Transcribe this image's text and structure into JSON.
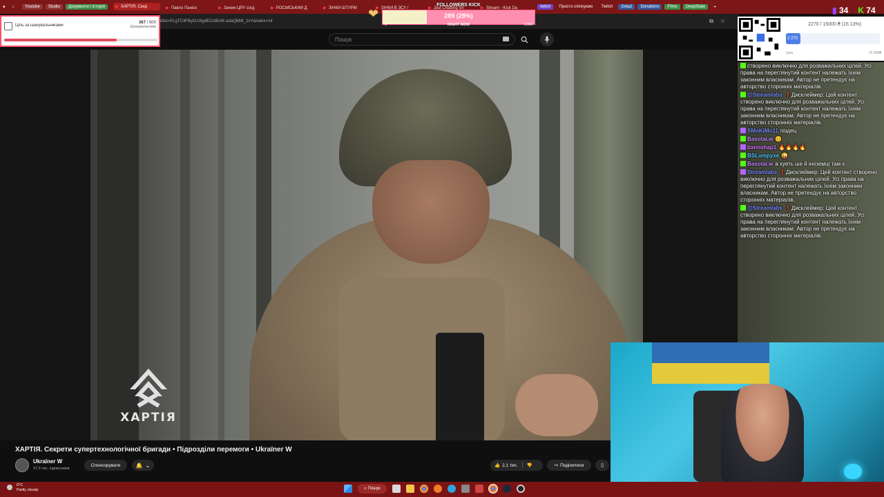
{
  "browser": {
    "bookmarks": [
      {
        "label": "Youtube",
        "color": "#8f3535"
      },
      {
        "label": "Studio",
        "color": "#8f3535"
      },
      {
        "label": "Документи і Історія",
        "color": "#3f8e4a"
      }
    ],
    "tabs": [
      {
        "label": "ХАРТІЯ. Секр",
        "active": true
      },
      {
        "label": "Павло Паніск"
      },
      {
        "label": "Зачем ЦРУ согд"
      },
      {
        "label": "РОСІЙСЬКИЙ Д"
      },
      {
        "label": "ЗІНКИ ШТУРМ"
      },
      {
        "label": "ЗІНКИ В ЗСУ /"
      },
      {
        "label": "Just Chatting Sh"
      },
      {
        "label": "Stream - Kick Da"
      }
    ],
    "bookmarks_right": [
      {
        "label": "twitch",
        "color": "#6b44c4"
      },
      {
        "label": "Просто спілкуємо",
        "color": "#7d1616"
      },
      {
        "label": "Twitch",
        "color": "#7d1616"
      },
      {
        "label": "Dota2",
        "color": "#365a9c"
      },
      {
        "label": "Donations",
        "color": "#365a9c"
      },
      {
        "label": "Films",
        "color": "#3f8e4a"
      },
      {
        "label": "DeepState",
        "color": "#3f8e4a"
      }
    ],
    "url": "dlist=PLgTC4FByDU3Ig4ECABAIK-edaQBMt_2xY&index=14"
  },
  "youtube": {
    "search_placeholder": "Пошук",
    "video_title": "ХАРТІЯ. Секрети супертехнологічної бригади • Підрозділи перемоги • Ukraїner W",
    "channel_name": "Ukraїner W",
    "channel_subs": "37,5 тис. підписників",
    "sponsor_label": "Спонсорувати",
    "like_count": "2,1 тис.",
    "share_label": "Поділитися",
    "logo_text": "ХАРТІЯ"
  },
  "widgets": {
    "goal": {
      "label": "Ціль за шанувальниками",
      "current": "367",
      "total": "/ 500",
      "subtitle": "Шанувальники",
      "progress": 0.734
    },
    "followers": {
      "label": "FOLLOWERS KICK",
      "count": "289 (28%)",
      "min": "0",
      "now": "RIGHT NOW",
      "max": "1000",
      "progress": 0.289
    },
    "viewers": {
      "twitch": "34",
      "kick": "74"
    },
    "donate": {
      "label": "2270 / 15000 ₴ (15.13%)",
      "bar_value": "2 270",
      "min": "Ціль",
      "max": "15 000₴",
      "progress": 0.1513
    }
  },
  "chat": [
    {
      "user": "",
      "text": "створено виключно для розважальних цілей. Усі права на переглянутий контент належать їхнім законним власникам. Автор не претендує на авторство сторонніх матеріалів.",
      "color": "#fff",
      "badge": "#53fc18"
    },
    {
      "user": "@Streamlabs",
      "text": "❗Дисклеймер: Цей контент створено виключно для розважальних цілей. Усі права на переглянутий контент належать їхнім законним власникам. Автор не претендує на авторство сторонніх матеріалів.",
      "color": "#7c8cff",
      "badge": "#53fc18"
    },
    {
      "user": "SMoKiMo11",
      "text": "піздец",
      "color": "#7c8cff",
      "badge": "#b267ff"
    },
    {
      "user": "Basotai.w",
      "text": "😊",
      "color": "#c48bff",
      "badge": "#53fc18"
    },
    {
      "user": "bannshap1",
      "text": "🔥🔥🔥🔥",
      "color": "#d27bff",
      "badge": "#b267ff"
    },
    {
      "user": "BSLumpyxe",
      "text": "😜",
      "color": "#53c8ff",
      "badge": "#53fc18"
    },
    {
      "user": "Basotai.w",
      "text": "а хуеть ше й іноземці там є",
      "color": "#c48bff",
      "badge": "#53fc18"
    },
    {
      "user": "Streamlabs",
      "text": "❗Дисклеймер: Цей контент створено виключно для розважальних цілей. Усі права на переглянутий контент належать їхнім законним власникам. Автор не претендує на авторство сторонніх матеріалів.",
      "color": "#7c8cff",
      "badge": "#b267ff"
    },
    {
      "user": "@Streamlabs",
      "text": "❗Дисклеймер: Цей контент створено виключно для розважальних цілей. Усі права на переглянутий контент належать їхнім законним власникам. Автор не претендує на авторство сторонніх матеріалів.",
      "color": "#7c8cff",
      "badge": "#53fc18"
    }
  ],
  "taskbar": {
    "temperature": "0°C",
    "weather": "Partly cloudy",
    "search_label": "Пошук"
  }
}
